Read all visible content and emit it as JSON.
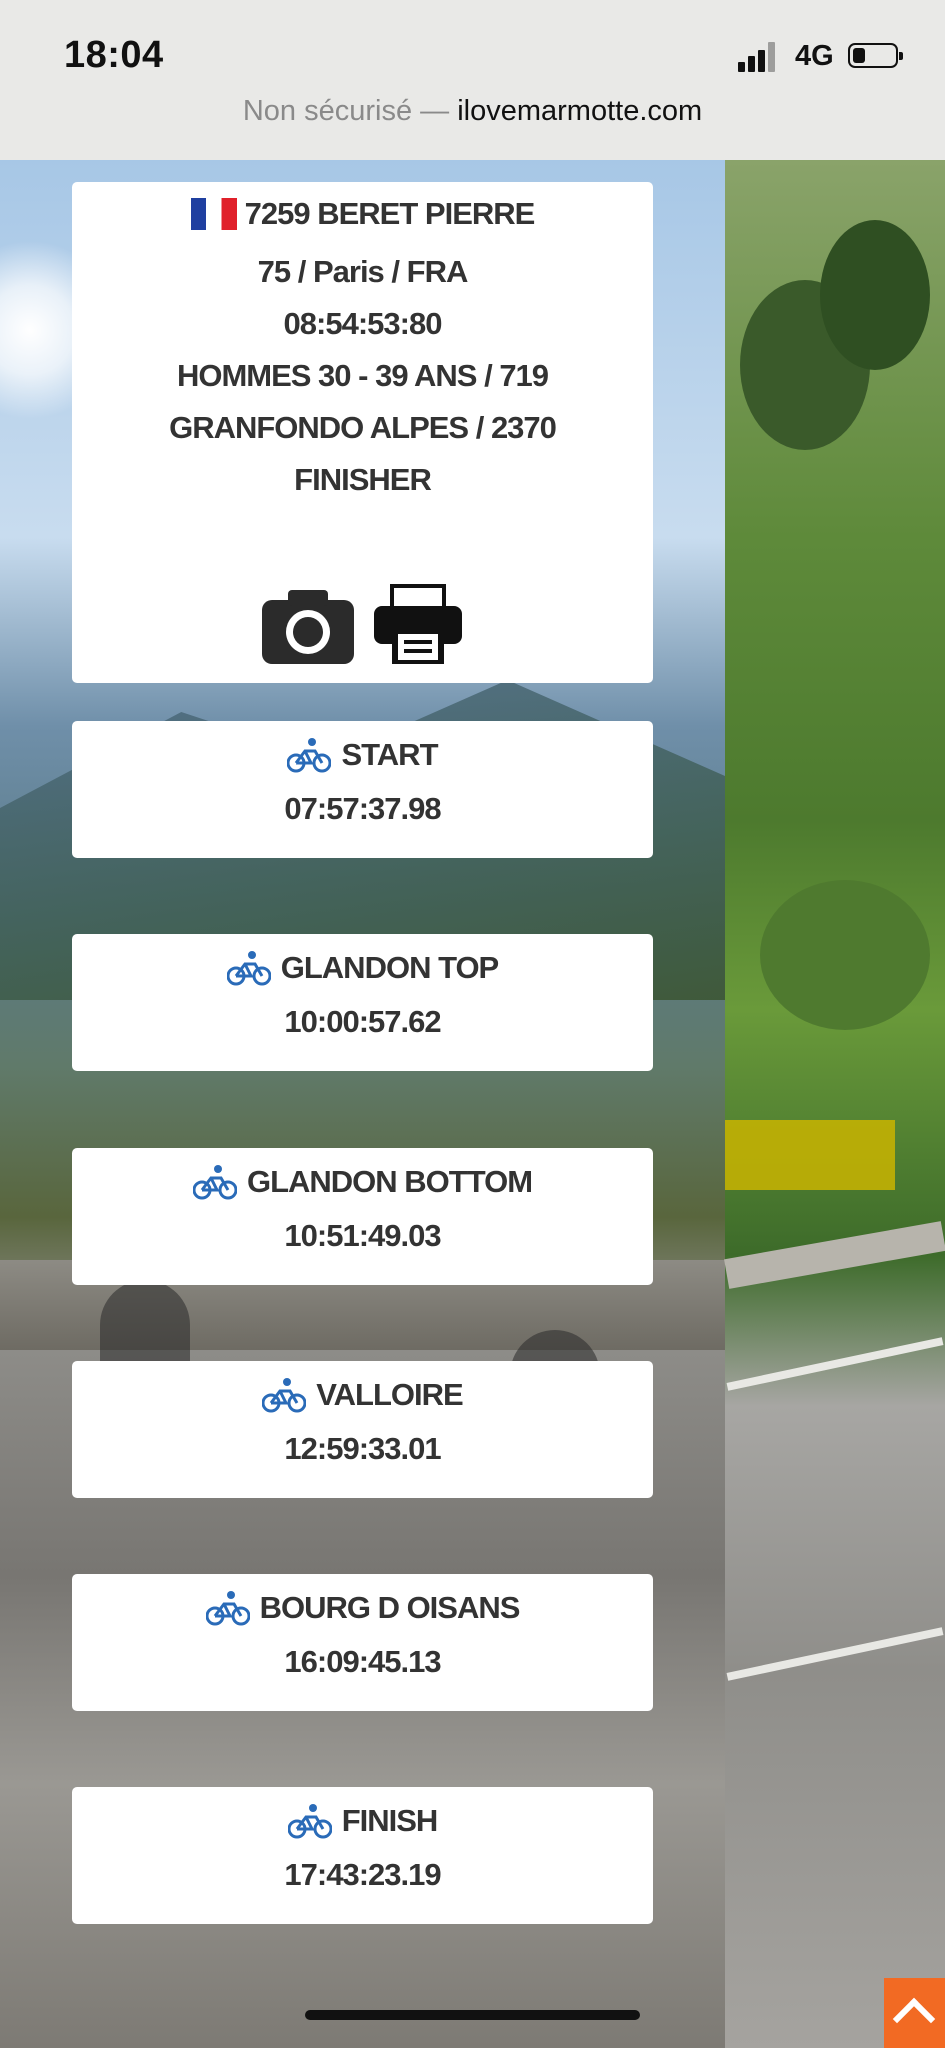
{
  "status": {
    "time": "18:04",
    "network": "4G"
  },
  "url_bar": {
    "security": "Non sécurisé —",
    "domain": "ilovemarmotte.com"
  },
  "rider": {
    "bib_name": "7259 BERET PIERRE",
    "location": "75 / Paris / FRA",
    "total_time": "08:54:53:80",
    "category": "HOMMES 30 - 39 ANS / 719",
    "race": "GRANFONDO ALPES / 2370",
    "status": "FINISHER",
    "flag_icon": "france-flag-icon",
    "camera_icon": "camera-icon",
    "print_icon": "printer-icon"
  },
  "splits": [
    {
      "label": "START",
      "time": "07:57:37.98"
    },
    {
      "label": "GLANDON TOP",
      "time": "10:00:57.62"
    },
    {
      "label": "GLANDON BOTTOM",
      "time": "10:51:49.03"
    },
    {
      "label": "VALLOIRE",
      "time": "12:59:33.01"
    },
    {
      "label": "BOURG D OISANS",
      "time": "16:09:45.13"
    },
    {
      "label": "FINISH",
      "time": "17:43:23.19"
    }
  ],
  "colors": {
    "accent": "#2a6bb8",
    "scroll_top": "#f26a23",
    "card_text": "#333333"
  }
}
